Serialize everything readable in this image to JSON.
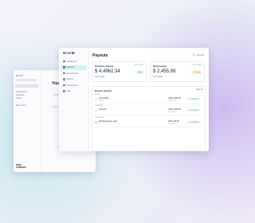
{
  "back_window": {
    "logo": "NIUM",
    "title": "Your",
    "nav": [
      "Transactions",
      "Accounts",
      "Cards",
      "More Items"
    ],
    "footer_line1": "NIUM",
    "footer_line2": "COMPANY"
  },
  "brand": {
    "logo": "NIUM",
    "accent": "#2f8f94"
  },
  "sidebar": {
    "items": [
      {
        "label": "Dashboard",
        "icon": "grid-icon",
        "active": false
      },
      {
        "label": "Payouts",
        "icon": "send-icon",
        "active": true
      },
      {
        "label": "Beneficiaries",
        "icon": "users-icon",
        "active": false
      },
      {
        "label": "Wallets",
        "icon": "wallet-icon",
        "active": false
      },
      {
        "label": "Transactions",
        "icon": "list-icon",
        "active": false
      },
      {
        "label": "Help",
        "icon": "help-icon",
        "active": false
      }
    ]
  },
  "header": {
    "title": "Payouts",
    "user": "Account"
  },
  "cards": [
    {
      "title": "Previous payout",
      "date": "Jul 1, 2022",
      "amount": "$ 4,4962.34",
      "badge": "Paid",
      "link": "View details"
    },
    {
      "title": "Next payout",
      "date": "Jul 5, 2022",
      "amount": "$ 2,455.99",
      "badge": "Pending",
      "link": "View details"
    }
  ],
  "activity": {
    "title": "Recent activity",
    "view_all": "View all",
    "groups": [
      {
        "label": "Today",
        "rows": [
          {
            "name": "ACH Debit",
            "sub": "Pay-out",
            "amount": "USD 4,962.34",
            "meta": "07/01/2022",
            "status": "● Completed"
          }
        ]
      },
      {
        "label": "Yesterday",
        "rows": [
          {
            "name": "Transfer",
            "sub": "",
            "amount": "USD 2,455.99",
            "meta": "06/30/2022",
            "status": "● Completed"
          }
        ]
      },
      {
        "label": "Last week",
        "rows": [
          {
            "name": "Exchange fees paid",
            "sub": "",
            "amount": "USD 128.50",
            "meta": "06/24/2022",
            "status": "● Completed"
          }
        ]
      }
    ]
  }
}
